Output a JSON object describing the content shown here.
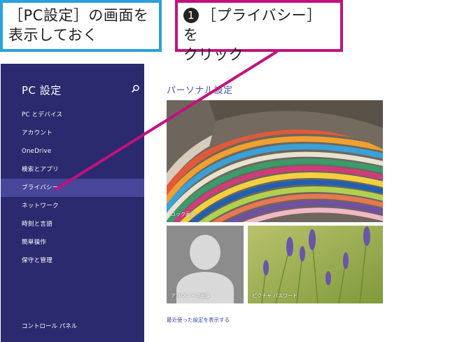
{
  "callouts": {
    "left": {
      "line1": "［PC設定］の画面を",
      "line2": "表示しておく"
    },
    "right": {
      "badge": "1",
      "line1": "［プライバシー］を",
      "line2": "クリック"
    }
  },
  "sidebar": {
    "title": "PC 設定",
    "search_icon": "search-icon",
    "items": [
      {
        "label": "PC とデバイス"
      },
      {
        "label": "アカウント"
      },
      {
        "label": "OneDrive"
      },
      {
        "label": "検索とアプリ"
      },
      {
        "label": "プライバシー"
      },
      {
        "label": "ネットワーク"
      },
      {
        "label": "時刻と言語"
      },
      {
        "label": "簡単操作"
      },
      {
        "label": "保守と管理"
      }
    ],
    "active_index": 4,
    "footer": "コントロール パネル"
  },
  "content": {
    "title": "パーソナル設定",
    "tiles": {
      "lock": "ロック画面",
      "account": "アカウントの画像",
      "picpass": "ピクチャ パスワード"
    },
    "recent_link": "最近使った設定を表示する"
  },
  "colors": {
    "sidebar_bg": "#2b2a6e",
    "sidebar_active": "#48479a",
    "accent_blue": "#2aa0dc",
    "accent_magenta": "#c0127f",
    "title_blue": "#4a55a5"
  }
}
